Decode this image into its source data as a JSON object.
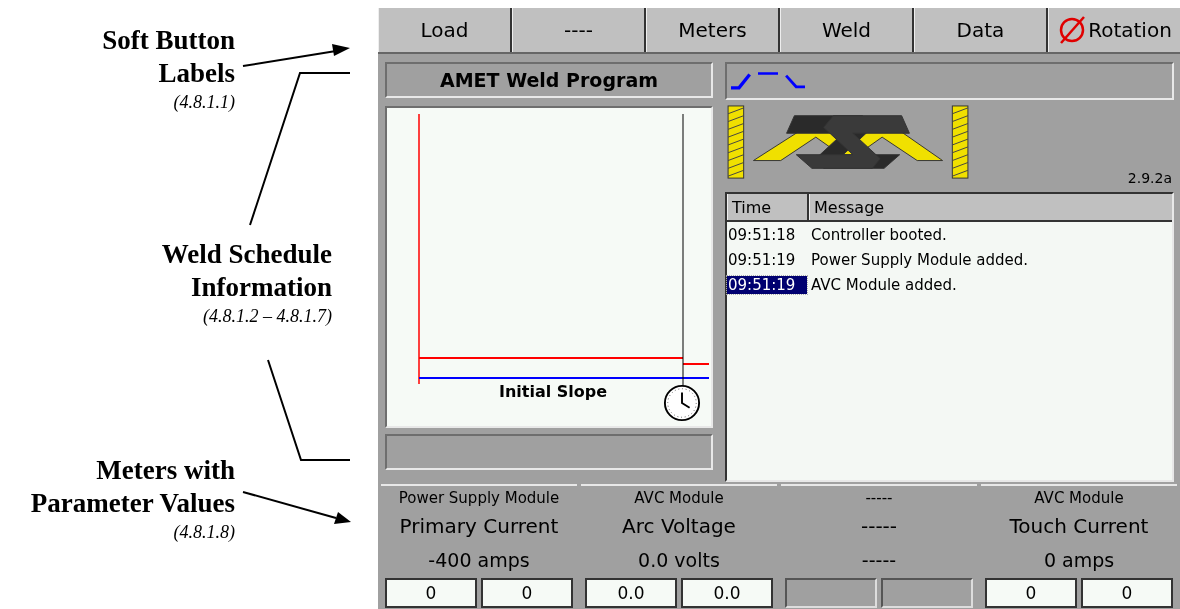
{
  "callouts": [
    {
      "title": "Soft Button Labels",
      "ref": "(4.8.1.1)"
    },
    {
      "title": "Weld Schedule Information",
      "ref": "(4.8.1.2 – 4.8.1.7)"
    },
    {
      "title": "Meters with Parameter Values",
      "ref": "(4.8.1.8)"
    }
  ],
  "soft_buttons": [
    {
      "label": "Load",
      "kind": "text"
    },
    {
      "label": "----",
      "kind": "text"
    },
    {
      "label": "Meters",
      "kind": "text"
    },
    {
      "label": "Weld",
      "kind": "text"
    },
    {
      "label": "Data",
      "kind": "text"
    },
    {
      "label": "Rotation",
      "kind": "prohibited"
    }
  ],
  "program": {
    "title": "AMET Weld Program",
    "graph_label": "Initial Slope"
  },
  "version": "2.9.2a",
  "log": {
    "columns": [
      "Time",
      "Message"
    ],
    "rows": [
      {
        "time": "09:51:18",
        "message": "Controller booted.",
        "selected": false
      },
      {
        "time": "09:51:19",
        "message": "Power Supply Module added.",
        "selected": false
      },
      {
        "time": "09:51:19",
        "message": "AVC Module added.",
        "selected": true
      }
    ]
  },
  "meters": [
    {
      "kind": "active",
      "module": "Power Supply Module",
      "parameter": "Primary Current",
      "value": "-400 amps",
      "cells": [
        "0",
        "0"
      ]
    },
    {
      "kind": "active",
      "module": "AVC Module",
      "parameter": "Arc Voltage",
      "value": "0.0 volts",
      "cells": [
        "0.0",
        "0.0"
      ]
    },
    {
      "kind": "blank",
      "module": "-----",
      "parameter": "-----",
      "value": "-----"
    },
    {
      "kind": "active",
      "module": "AVC Module",
      "parameter": "Touch Current",
      "value": "0 amps",
      "cells": [
        "0",
        "0"
      ]
    }
  ]
}
